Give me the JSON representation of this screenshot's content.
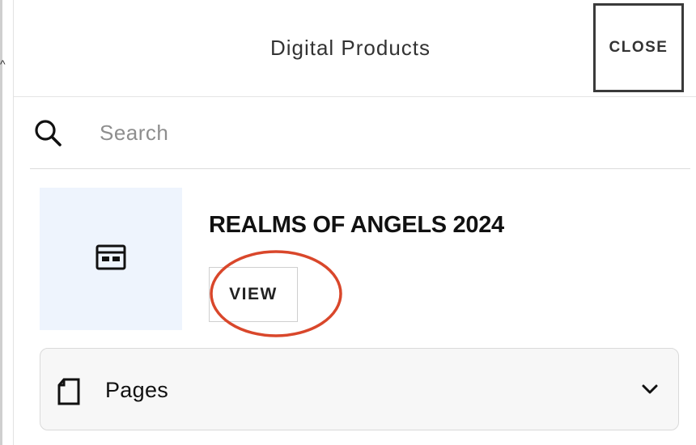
{
  "window": {
    "left_edge_glyph": "^"
  },
  "header": {
    "title": "Digital Products",
    "close_label": "CLOSE"
  },
  "search": {
    "placeholder": "Search",
    "value": "",
    "icon": "search-icon"
  },
  "product": {
    "name": "REALMS OF ANGELS 2024",
    "view_label": "VIEW",
    "thumbnail_icon": "layout-template-icon",
    "thumbnail_bg": "#eef4fd",
    "highlight_color": "#d9472b"
  },
  "pages_section": {
    "label": "Pages",
    "icon": "page-icon",
    "toggle_icon": "chevron-down-icon",
    "expanded": false
  }
}
